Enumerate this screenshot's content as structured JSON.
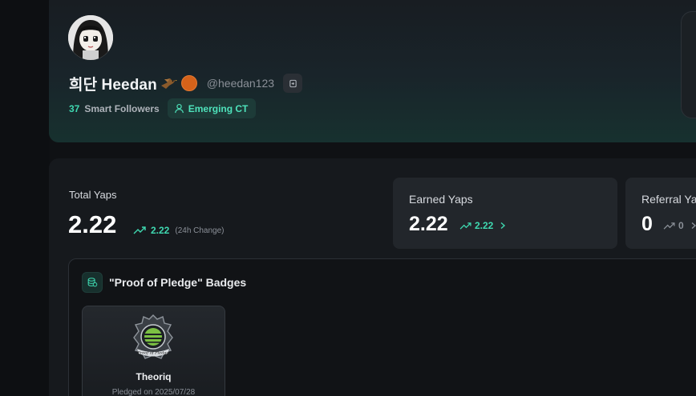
{
  "profile": {
    "display_name": "희단 Heedan",
    "handle": "@heedan123",
    "smart_followers_count": "37",
    "smart_followers_label": "Smart Followers",
    "tier_badge": "Emerging CT",
    "accent_color": "#3fd9b1"
  },
  "stats": {
    "total": {
      "label": "Total Yaps",
      "value": "2.22",
      "change": "2.22",
      "change_note": "(24h Change)"
    },
    "earned": {
      "label": "Earned Yaps",
      "value": "2.22",
      "change": "2.22"
    },
    "referral": {
      "label": "Referral Ya",
      "value": "0",
      "change": "0"
    }
  },
  "badges": {
    "title": "\"Proof of Pledge\" Badges",
    "items": [
      {
        "name": "Theoriq",
        "date": "Pledged on 2025/07/28",
        "emblem_text": "Proof of Pledge"
      }
    ]
  },
  "icons": {
    "bird": "bird-emoji-icon",
    "copy": "copy-icon",
    "user": "user-icon",
    "trend": "trending-up-icon",
    "chevron": "chevron-right-icon",
    "coins": "coins-icon"
  }
}
